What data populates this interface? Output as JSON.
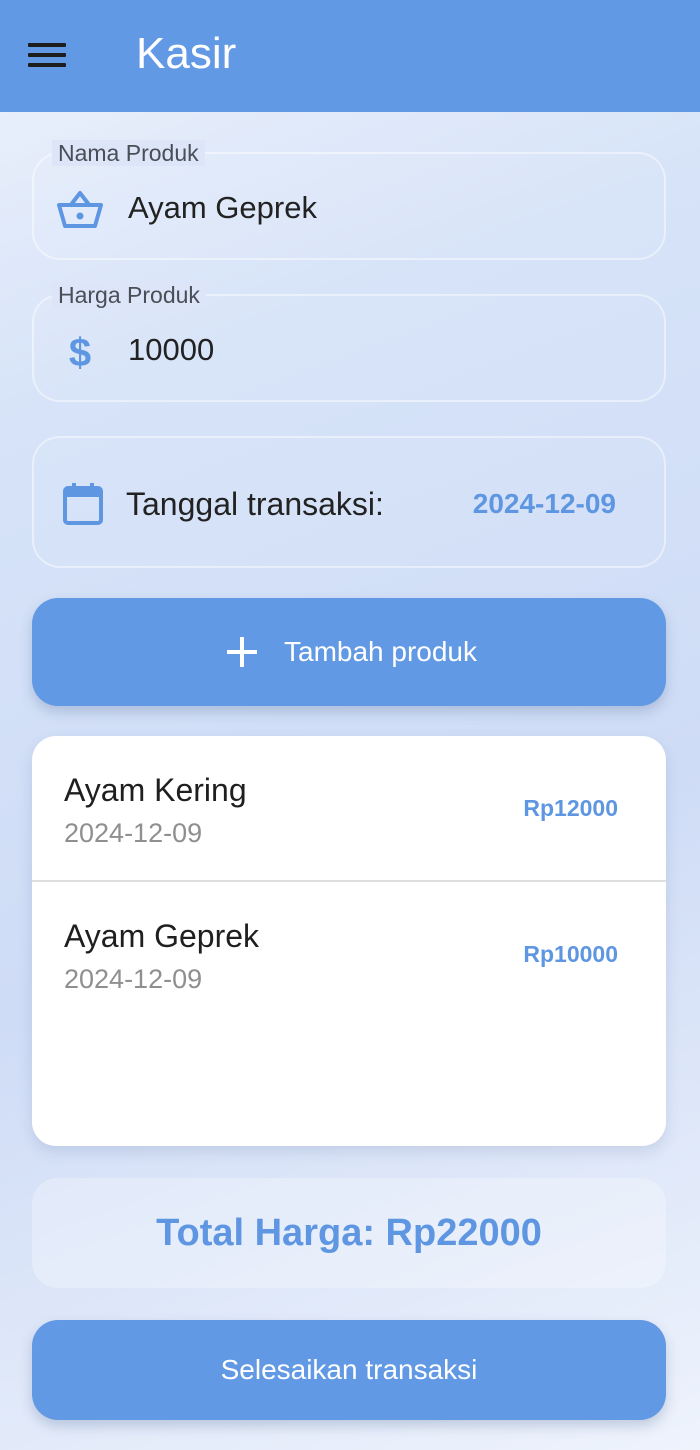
{
  "app": {
    "title": "Kasir"
  },
  "form": {
    "product_name": {
      "label": "Nama Produk",
      "value": "Ayam Geprek"
    },
    "product_price": {
      "label": "Harga Produk",
      "value": "10000"
    },
    "date": {
      "label": "Tanggal transaksi:",
      "value": "2024-12-09"
    }
  },
  "buttons": {
    "add_product": "Tambah produk",
    "finish": "Selesaikan transaksi"
  },
  "items": [
    {
      "name": "Ayam Kering",
      "date": "2024-12-09",
      "price": "Rp12000"
    },
    {
      "name": "Ayam Geprek",
      "date": "2024-12-09",
      "price": "Rp10000"
    }
  ],
  "total": {
    "text": "Total Harga: Rp22000"
  },
  "colors": {
    "primary": "#6199e4",
    "accent_text": "#5e96e2"
  },
  "icons": [
    "menu-icon",
    "basket-icon",
    "dollar-icon",
    "calendar-icon",
    "plus-icon"
  ]
}
